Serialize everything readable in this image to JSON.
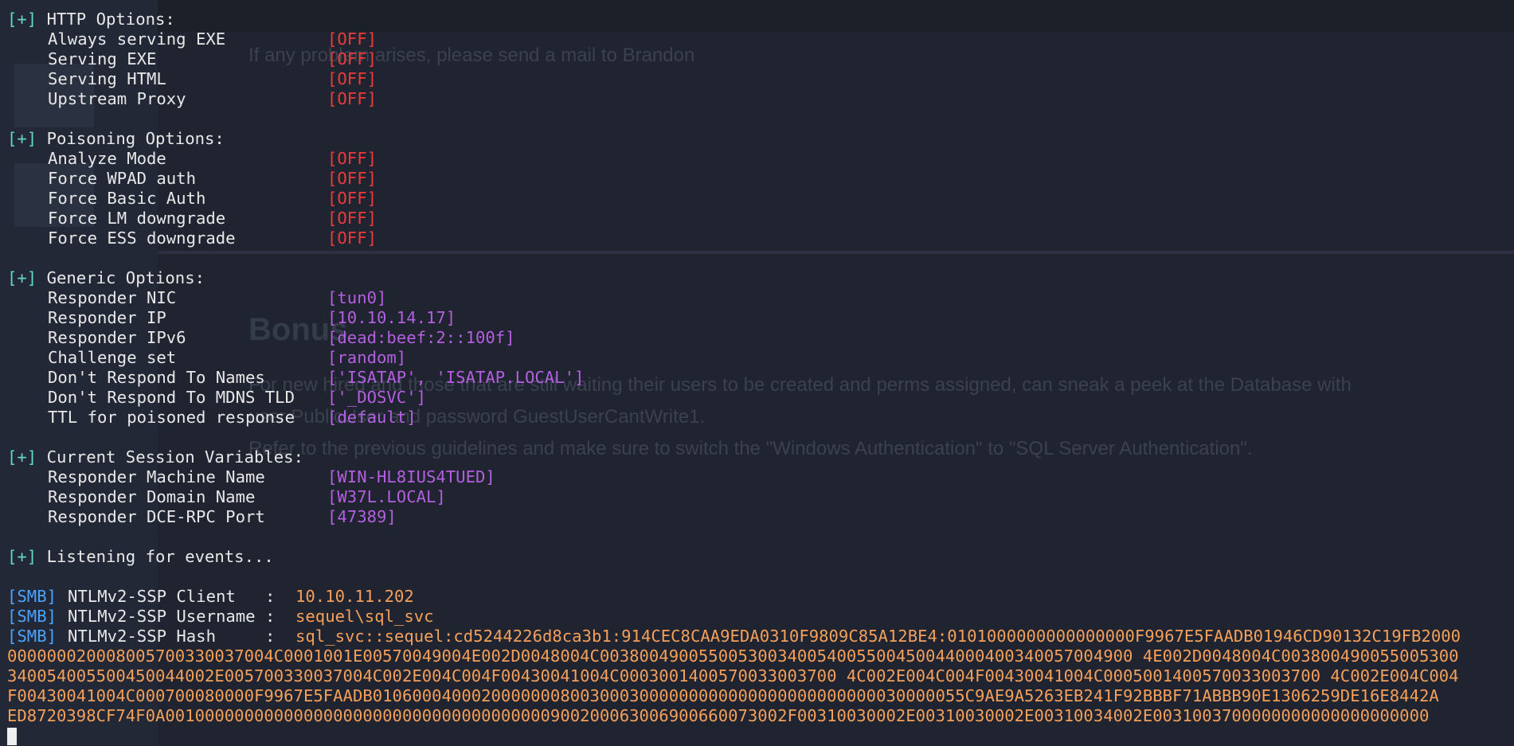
{
  "background_page": {
    "sentence_1": "If any problem arises, please send a mail to Brandon",
    "link_name": "Brandon",
    "heading": "Bonus",
    "para_line_1": "For new hired and those that are still waiting their users to be created and perms assigned, can sneak a peek at the Database with",
    "para_line_2": "user PublicUser and password GuestUserCantWrite1.",
    "para_line_3": "Refer to the previous guidelines and make sure to switch the \"Windows Authentication\" to \"SQL Server Authentication\"."
  },
  "terminal": {
    "marker": "[+]",
    "http_options": {
      "title": "HTTP Options:",
      "items": [
        {
          "label": "Always serving EXE",
          "value": "[OFF]"
        },
        {
          "label": "Serving EXE",
          "value": "[OFF]"
        },
        {
          "label": "Serving HTML",
          "value": "[OFF]"
        },
        {
          "label": "Upstream Proxy",
          "value": "[OFF]"
        }
      ]
    },
    "poisoning_options": {
      "title": "Poisoning Options:",
      "items": [
        {
          "label": "Analyze Mode",
          "value": "[OFF]"
        },
        {
          "label": "Force WPAD auth",
          "value": "[OFF]"
        },
        {
          "label": "Force Basic Auth",
          "value": "[OFF]"
        },
        {
          "label": "Force LM downgrade",
          "value": "[OFF]"
        },
        {
          "label": "Force ESS downgrade",
          "value": "[OFF]"
        }
      ]
    },
    "generic_options": {
      "title": "Generic Options:",
      "items": [
        {
          "label": "Responder NIC",
          "value": "[tun0]"
        },
        {
          "label": "Responder IP",
          "value": "[10.10.14.17]"
        },
        {
          "label": "Responder IPv6",
          "value": "[dead:beef:2::100f]"
        },
        {
          "label": "Challenge set",
          "value": "[random]"
        },
        {
          "label": "Don't Respond To Names",
          "value": "['ISATAP', 'ISATAP.LOCAL']"
        },
        {
          "label": "Don't Respond To MDNS TLD",
          "value": "['_DOSVC']"
        },
        {
          "label": "TTL for poisoned response",
          "value": "[default]"
        }
      ]
    },
    "session_variables": {
      "title": "Current Session Variables:",
      "items": [
        {
          "label": "Responder Machine Name",
          "value": "[WIN-HL8IUS4TUED]"
        },
        {
          "label": "Responder Domain Name",
          "value": "[W37L.LOCAL]"
        },
        {
          "label": "Responder DCE-RPC Port",
          "value": "[47389]"
        }
      ]
    },
    "listening": "Listening for events...",
    "smb_tag": "[SMB]",
    "smb": {
      "client_label": "NTLMv2-SSP Client   :",
      "client_value": "10.10.11.202",
      "username_label": "NTLMv2-SSP Username :",
      "username_value": "sequel\\sql_svc",
      "hash_label": "NTLMv2-SSP Hash     :",
      "hash_value_first": "sql_svc::sequel:cd5244226d8ca3b1:914CEC8CAA9EDA0310F9809C85A12BE4:0101000000000000000F9967E5FAADB01946CD90132C19FB2000",
      "hash_cont": [
        "000000020008005700330037004C0001001E00570049004E002D0048004C003800490055005300340054005500450044000400340057004900 4E002D0048004C003800490055005300",
        "340054005500450044002E005700330037004C002E004C004F00430041004C0003001400570033003700 4C002E004C004F00430041004C0005001400570033003700 4C002E004C004",
        "F00430041004C000700080000F9967E5FAADB010600040002000000080030003000000000000000000000000030000055C9AE9A5263EB241F92BBBF71ABBB90E1306259DE16E8442A",
        "ED8720398CF74F0A001000000000000000000000000000000000000900200063006900660073002F00310030002E00310030002E00310034002E0031003700000000000000000000"
      ]
    }
  }
}
